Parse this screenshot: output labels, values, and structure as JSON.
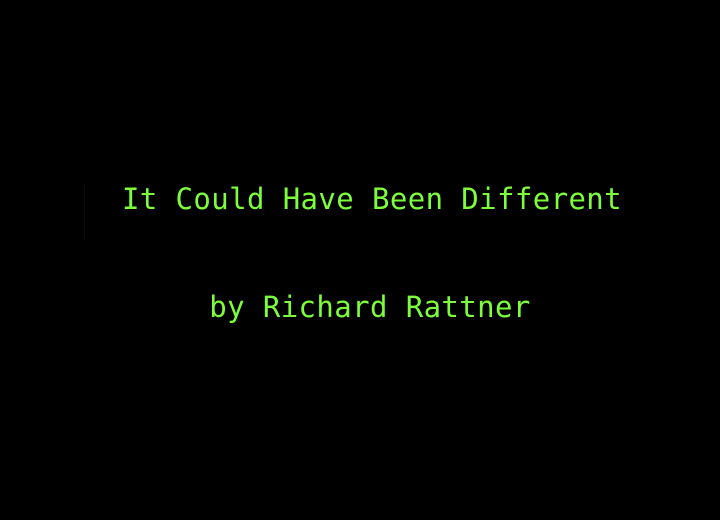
{
  "screen": {
    "title": "It Could Have Been Different",
    "byline": "by Richard Rattner",
    "background_color": "#000000",
    "text_color": "#7cff3a"
  }
}
